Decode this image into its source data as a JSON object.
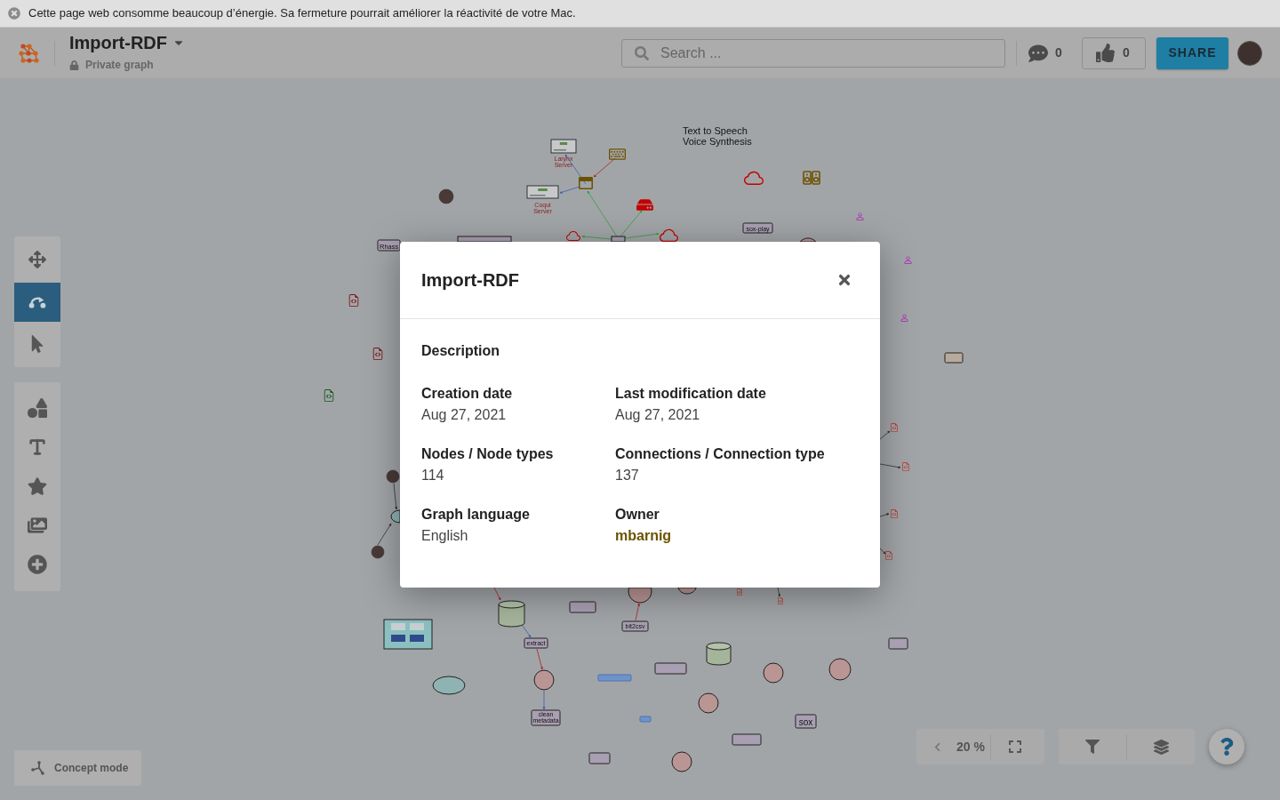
{
  "browser_banner": {
    "message": "Cette page web consomme beaucoup d’énergie. Sa fermeture pourrait améliorer la réactivité de votre Mac."
  },
  "header": {
    "title": "Import-RDF",
    "visibility": "Private graph",
    "search": {
      "placeholder": "Search ..."
    },
    "comments": "0",
    "likes": "0",
    "share": "SHARE"
  },
  "toolbar": {
    "modes": [
      {
        "kind": "move",
        "selected": false
      },
      {
        "kind": "connect",
        "selected": true
      },
      {
        "kind": "select",
        "selected": false
      }
    ],
    "tools": [
      {
        "kind": "shapes"
      },
      {
        "kind": "text"
      },
      {
        "kind": "star"
      },
      {
        "kind": "images"
      },
      {
        "kind": "add"
      }
    ]
  },
  "concept_mode": "Concept mode",
  "zoom": {
    "reading": "20 %"
  },
  "graph": {
    "labels": [
      {
        "kind": "caption",
        "text": "Text to Speech\nVoice Synthesis"
      },
      {
        "kind": "screenshot",
        "text": "Larynx\nServer"
      },
      {
        "kind": "screenshot",
        "text": "Coqui\nServer"
      },
      {
        "kind": "box",
        "text": "sox-play"
      },
      {
        "kind": "box",
        "text": "Rhass"
      },
      {
        "kind": "box",
        "text": "extract"
      },
      {
        "kind": "box",
        "text": "bit2csv"
      },
      {
        "kind": "box",
        "text": "clean\nmetadata"
      },
      {
        "kind": "box",
        "text": "sox"
      }
    ]
  },
  "dialog": {
    "title": "Import-RDF",
    "description_label": "Description",
    "fields": [
      {
        "kind": "text",
        "label": "Creation date",
        "value": "Aug 27, 2021"
      },
      {
        "kind": "text",
        "label": "Last modification date",
        "value": "Aug 27, 2021"
      },
      {
        "kind": "text",
        "label": "Nodes / Node types",
        "value": "114"
      },
      {
        "kind": "text",
        "label": "Connections / Connection type",
        "value": "137"
      },
      {
        "kind": "text",
        "label": "Graph language",
        "value": "English"
      },
      {
        "kind": "link",
        "label": "Owner",
        "value": "mbarnig"
      }
    ]
  }
}
